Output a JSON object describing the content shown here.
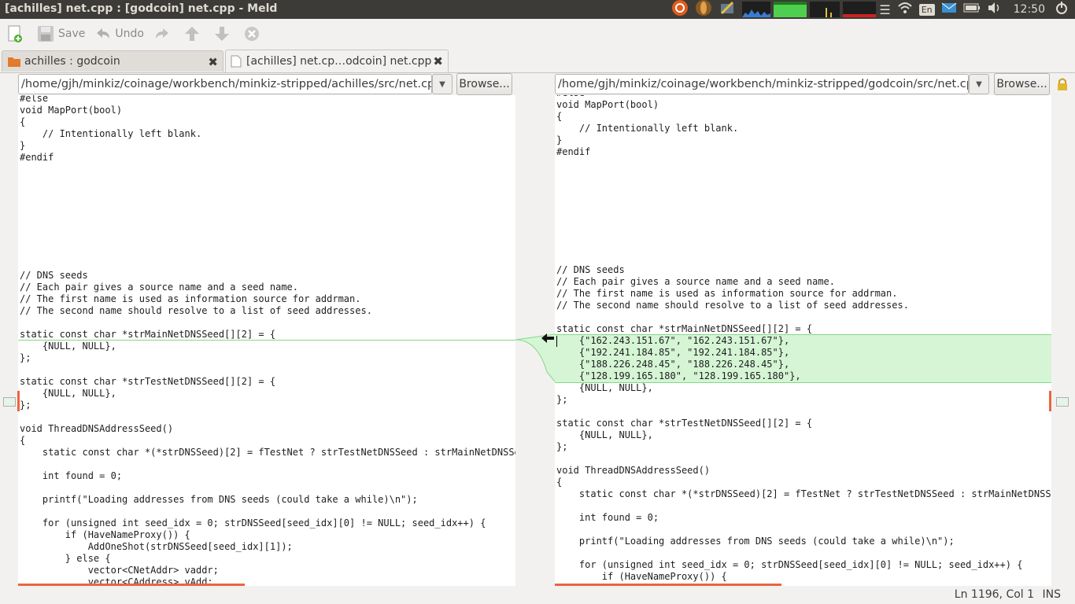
{
  "window": {
    "title": "[achilles] net.cpp : [godcoin] net.cpp - Meld"
  },
  "tray": {
    "clock": "12:50",
    "keyboard": "En"
  },
  "toolbar": {
    "save_label": "Save",
    "undo_label": "Undo"
  },
  "tabs": [
    {
      "label": "achilles : godcoin",
      "icon": "folder-icon"
    },
    {
      "label": "[achilles] net.cp…odcoin] net.cpp",
      "icon": "file-icon"
    }
  ],
  "left": {
    "path": "/home/gjh/minkiz/coinage/workbench/minkiz-stripped/achilles/src/net.cpp",
    "browse_label": "Browse...",
    "code": "#else\nvoid MapPort(bool)\n{\n    // Intentionally left blank.\n}\n#endif\n\n\n\n\n\n\n\n\n\n// DNS seeds\n// Each pair gives a source name and a seed name.\n// The first name is used as information source for addrman.\n// The second name should resolve to a list of seed addresses.\n\nstatic const char *strMainNetDNSSeed[][2] = {\n    {NULL, NULL},\n};\n\nstatic const char *strTestNetDNSSeed[][2] = {\n    {NULL, NULL},\n};\n\nvoid ThreadDNSAddressSeed()\n{\n    static const char *(*strDNSSeed)[2] = fTestNet ? strTestNetDNSSeed : strMainNetDNSSeed\n\n    int found = 0;\n\n    printf(\"Loading addresses from DNS seeds (could take a while)\\n\");\n\n    for (unsigned int seed_idx = 0; strDNSSeed[seed_idx][0] != NULL; seed_idx++) {\n        if (HaveNameProxy()) {\n            AddOneShot(strDNSSeed[seed_idx][1]);\n        } else {\n            vector<CNetAddr> vaddr;\n            vector<CAddress> vAdd;"
  },
  "right": {
    "path": "/home/gjh/minkiz/coinage/workbench/minkiz-stripped/godcoin/src/net.cpp",
    "browse_label": "Browse...",
    "code": "#else\nvoid MapPort(bool)\n{\n    // Intentionally left blank.\n}\n#endif\n\n\n\n\n\n\n\n\n\n// DNS seeds\n// Each pair gives a source name and a seed name.\n// The first name is used as information source for addrman.\n// The second name should resolve to a list of seed addresses.\n\nstatic const char *strMainNetDNSSeed[][2] = {\n    {\"162.243.151.67\", \"162.243.151.67\"},\n    {\"192.241.184.85\", \"192.241.184.85\"},\n    {\"188.226.248.45\", \"188.226.248.45\"},\n    {\"128.199.165.180\", \"128.199.165.180\"},\n    {NULL, NULL},\n};\n\nstatic const char *strTestNetDNSSeed[][2] = {\n    {NULL, NULL},\n};\n\nvoid ThreadDNSAddressSeed()\n{\n    static const char *(*strDNSSeed)[2] = fTestNet ? strTestNetDNSSeed : strMainNetDNSSeed\n\n    int found = 0;\n\n    printf(\"Loading addresses from DNS seeds (could take a while)\\n\");\n\n    for (unsigned int seed_idx = 0; strDNSSeed[seed_idx][0] != NULL; seed_idx++) {\n        if (HaveNameProxy()) {"
  },
  "status": {
    "position": "Ln 1196, Col 1",
    "mode": "INS"
  },
  "colors": {
    "insert_bg": "#d5f5d5",
    "insert_border": "#83d983",
    "change_marker": "#e9663f"
  }
}
